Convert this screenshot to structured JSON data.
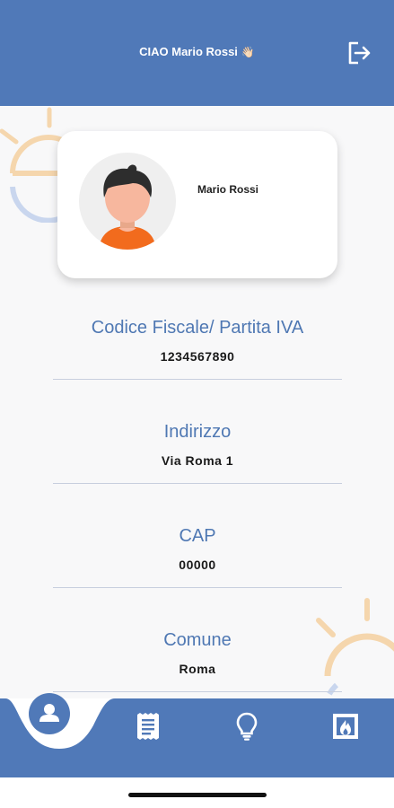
{
  "header": {
    "greeting": "CIAO Mario Rossi",
    "greeting_emoji": "👋🏻",
    "logout_icon": "logout-icon"
  },
  "profile": {
    "name": "Mario Rossi",
    "avatar_icon": "avatar-icon"
  },
  "fields": [
    {
      "label": "Codice Fiscale/ Partita IVA",
      "value": "1234567890"
    },
    {
      "label": "Indirizzo",
      "value": "Via Roma 1"
    },
    {
      "label": "CAP",
      "value": "00000"
    },
    {
      "label": "Comune",
      "value": "Roma"
    }
  ],
  "bottom_nav": {
    "items": [
      {
        "icon": "user-icon",
        "active": true
      },
      {
        "icon": "receipt-icon",
        "active": false
      },
      {
        "icon": "lightbulb-icon",
        "active": false
      },
      {
        "icon": "flame-icon",
        "active": false
      }
    ]
  },
  "colors": {
    "primary": "#5079b8",
    "label": "#4f78b3",
    "background": "#f8f8f9",
    "deco_orange": "#f5d6ad",
    "deco_blue": "#c9d6ee"
  }
}
